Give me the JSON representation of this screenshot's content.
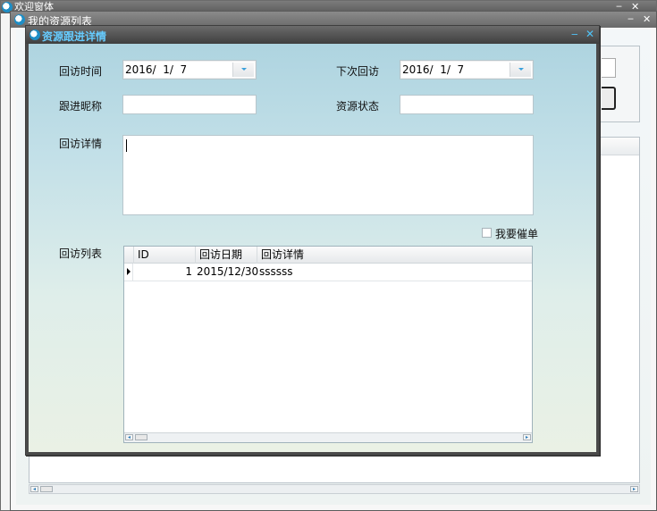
{
  "window_back": {
    "title": "欢迎窗体"
  },
  "window_middle": {
    "title": "我的资源列表"
  },
  "dialog": {
    "title": "资源跟进详情",
    "fields": {
      "visit_time_label": "回访时间",
      "visit_time_value": "2016/  1/  7",
      "next_visit_label": "下次回访",
      "next_visit_value": "2016/  1/  7",
      "nickname_label": "跟进昵称",
      "nickname_value": "",
      "status_label": "资源状态",
      "status_value": "",
      "details_label": "回访详情",
      "details_value": ""
    },
    "urge_checkbox_label": "我要催单",
    "urge_checked": false,
    "list_label": "回访列表",
    "grid": {
      "columns": [
        "ID",
        "回访日期",
        "回访详情"
      ],
      "rows": [
        {
          "id": "1",
          "date": "2015/12/30",
          "detail": "ssssss"
        }
      ]
    }
  },
  "icons": {
    "app": "app-logo-icon",
    "minimize": "minimize-icon",
    "close": "close-icon",
    "dropdown": "dropdown-arrow-icon",
    "row_pointer": "row-pointer-icon",
    "scroll_left": "scroll-left-icon",
    "scroll_right": "scroll-right-icon"
  },
  "colors": {
    "dialog_title": "#66ccff",
    "titlebar": "#4a4a4a",
    "content_top": "#aed4e0",
    "content_bottom": "#eaf1e5"
  }
}
